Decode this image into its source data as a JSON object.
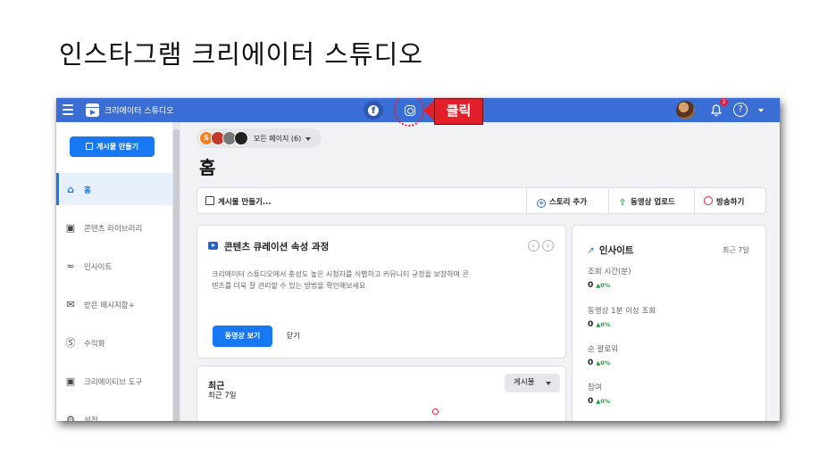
{
  "slide": {
    "title": "인스타그램 크리에이터 스튜디오"
  },
  "annotation": {
    "click_label": "클릭"
  },
  "topbar": {
    "app_title": "크리에이터 스튜디오",
    "facebook_glyph": "f",
    "notification_count": "2",
    "help_glyph": "?"
  },
  "sidebar": {
    "create_button": "게시물 만들기",
    "items": [
      {
        "label": "홈",
        "icon": "home-icon",
        "active": true
      },
      {
        "label": "콘텐츠 라이브러리",
        "icon": "library-icon"
      },
      {
        "label": "인사이트",
        "icon": "insights-icon"
      },
      {
        "label": "받은 메시지함+",
        "icon": "inbox-icon"
      },
      {
        "label": "수익화",
        "icon": "dollar-icon"
      },
      {
        "label": "크리에이티브 도구",
        "icon": "tools-icon"
      },
      {
        "label": "설정",
        "icon": "settings-icon"
      }
    ]
  },
  "main": {
    "page_selector": {
      "avatar_initial": "S",
      "label": "모든 페이지 (6)"
    },
    "page_title": "홈",
    "action_bar": {
      "create_post": "게시물 만들기...",
      "add_story": "스토리 추가",
      "upload_video": "동영상 업로드",
      "go_live": "방송하기"
    },
    "curation_card": {
      "title": "콘텐츠 큐레이션 속성 과정",
      "description": "크리에이터 스튜디오에서 충성도 높은 시청자를 식별하고 커뮤니티 규정을 보장하며 콘텐츠를 더욱 잘 관리할 수 있는 방법을 확인해보세요",
      "primary_button": "동영상 보기",
      "secondary_button": "닫기"
    },
    "recent_card": {
      "title": "최근",
      "subtitle": "최근 7일",
      "dropdown_value": "게시물"
    },
    "insights_card": {
      "title": "인사이트",
      "range": "최근 7일",
      "metrics": [
        {
          "label": "조회 시간(분)",
          "value": "0",
          "delta": "▲0%"
        },
        {
          "label": "동영상 1분 이상 조회",
          "value": "0",
          "delta": "▲0%"
        },
        {
          "label": "순 팔로워",
          "value": "0",
          "delta": "▲0%"
        },
        {
          "label": "참여",
          "value": "0",
          "delta": "▲0%"
        }
      ]
    }
  },
  "colors": {
    "topbar": "#3b6ed4",
    "primary": "#1877f2",
    "annotation_red": "#e3202a",
    "positive": "#1b9c3a"
  }
}
